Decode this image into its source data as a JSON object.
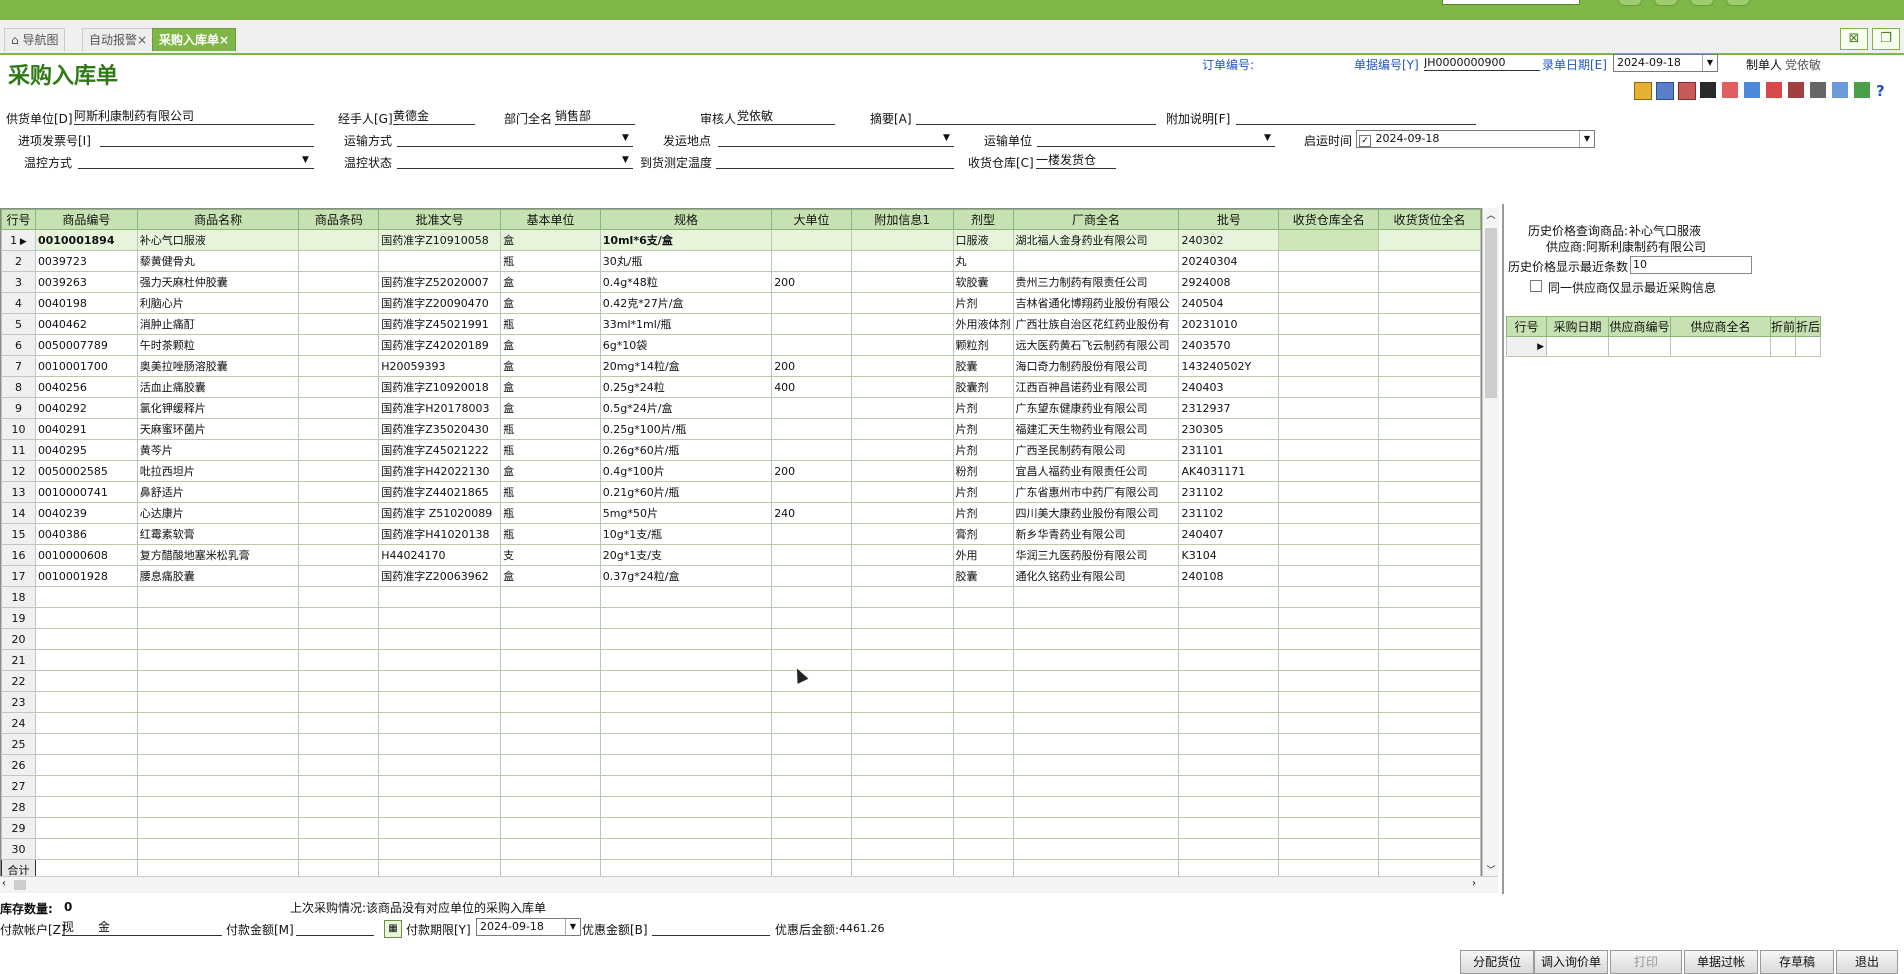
{
  "tabs": [
    {
      "label": "导航图",
      "icon": "home-icon"
    },
    {
      "label": "自动报警"
    },
    {
      "label": "采购入库单"
    }
  ],
  "page_title": "采购入库单",
  "header_top": {
    "order_no_label": "订单编号:",
    "doc_no_label": "单据编号[Y]",
    "doc_no_value": "JH0000000900",
    "entry_date_label": "录单日期[E]",
    "entry_date_value": "2024-09-18",
    "maker_label": "制单人",
    "maker_value": "党依敏"
  },
  "form": {
    "supplier_label": "供货单位[D]",
    "supplier_value": "阿斯利康制药有限公司",
    "handler_label": "经手人[G]",
    "handler_value": "黄德金",
    "dept_label": "部门全名",
    "dept_value": "销售部",
    "auditor_label": "审核人",
    "auditor_value": "党依敏",
    "summary_label": "摘要[A]",
    "summary_value": "",
    "extra_label": "附加说明[F]",
    "extra_value": "",
    "invoice_label": "进项发票号[I]",
    "transport_label": "运输方式",
    "ship_place_label": "发运地点",
    "carrier_label": "运输单位",
    "start_time_label": "启运时间",
    "start_time_value": "2024-09-18",
    "temp_method_label": "温控方式",
    "temp_status_label": "温控状态",
    "arrival_temp_label": "到货测定温度",
    "warehouse_label": "收货仓库[C]",
    "warehouse_value": "一楼发货仓"
  },
  "grid": {
    "columns": [
      "行号",
      "商品编号",
      "商品名称",
      "商品条码",
      "批准文号",
      "基本单位",
      "规格",
      "大单位",
      "附加信息1",
      "剂型",
      "厂商全名",
      "批号",
      "收货仓库全名",
      "收货货位全名"
    ],
    "rows": [
      [
        "1",
        "0010001894",
        "补心气口服液",
        "",
        "国药准字Z10910058",
        "盒",
        "10ml*6支/盒",
        "",
        "",
        "口服液",
        "湖北福人金身药业有限公司",
        "240302",
        "",
        ""
      ],
      [
        "2",
        "0039723",
        "藜黄健骨丸",
        "",
        "",
        "瓶",
        "30丸/瓶",
        "",
        "",
        "丸",
        "",
        "20240304",
        "",
        ""
      ],
      [
        "3",
        "0039263",
        "强力天麻杜仲胶囊",
        "",
        "国药准字Z52020007",
        "盒",
        "0.4g*48粒",
        "200",
        "",
        "软胶囊",
        "贵州三力制药有限责任公司",
        "2924008",
        "",
        ""
      ],
      [
        "4",
        "0040198",
        "利脑心片",
        "",
        "国药准字Z20090470",
        "盒",
        "0.42克*27片/盒",
        "",
        "",
        "片剂",
        "吉林省通化博翔药业股份有限公",
        "240504",
        "",
        ""
      ],
      [
        "5",
        "0040462",
        "消肿止痛酊",
        "",
        "国药准字Z45021991",
        "瓶",
        "33ml*1ml/瓶",
        "",
        "",
        "外用液体剂",
        "广西壮族自治区花红药业股份有",
        "20231010",
        "",
        ""
      ],
      [
        "6",
        "0050007789",
        "午时茶颗粒",
        "",
        "国药准字Z42020189",
        "盒",
        "6g*10袋",
        "",
        "",
        "颗粒剂",
        "远大医药黄石飞云制药有限公司",
        "2403570",
        "",
        ""
      ],
      [
        "7",
        "0010001700",
        "奥美拉唑肠溶胶囊",
        "",
        "H20059393",
        "盒",
        "20mg*14粒/盒",
        "200",
        "",
        "胶囊",
        "海口奇力制药股份有限公司",
        "143240502Y",
        "",
        ""
      ],
      [
        "8",
        "0040256",
        "活血止痛胶囊",
        "",
        "国药准字Z10920018",
        "盒",
        "0.25g*24粒",
        "400",
        "",
        "胶囊剂",
        "江西百神昌诺药业有限公司",
        "240403",
        "",
        ""
      ],
      [
        "9",
        "0040292",
        "氯化钾缓释片",
        "",
        "国药准字H20178003",
        "盒",
        "0.5g*24片/盒",
        "",
        "",
        "片剂",
        "广东望东健康药业有限公司",
        "2312937",
        "",
        ""
      ],
      [
        "10",
        "0040291",
        "天麻蜜环菌片",
        "",
        "国药准字Z35020430",
        "瓶",
        "0.25g*100片/瓶",
        "",
        "",
        "片剂",
        "福建汇天生物药业有限公司",
        "230305",
        "",
        ""
      ],
      [
        "11",
        "0040295",
        "黄芩片",
        "",
        "国药准字Z45021222",
        "瓶",
        "0.26g*60片/瓶",
        "",
        "",
        "片剂",
        "广西圣民制药有限公司",
        "231101",
        "",
        ""
      ],
      [
        "12",
        "0050002585",
        "吡拉西坦片",
        "",
        "国药准字H42022130",
        "盒",
        "0.4g*100片",
        "200",
        "",
        "粉剂",
        "宜昌人福药业有限责任公司",
        "AK4031171",
        "",
        ""
      ],
      [
        "13",
        "0010000741",
        "鼻舒适片",
        "",
        "国药准字Z44021865",
        "瓶",
        "0.21g*60片/瓶",
        "",
        "",
        "片剂",
        "广东省惠州市中药厂有限公司",
        "231102",
        "",
        ""
      ],
      [
        "14",
        "0040239",
        "心达康片",
        "",
        "国药准字 Z51020089",
        "瓶",
        "5mg*50片",
        "240",
        "",
        "片剂",
        "四川美大康药业股份有限公司",
        "231102",
        "",
        ""
      ],
      [
        "15",
        "0040386",
        "红霉素软膏",
        "",
        "国药准字H41020138",
        "瓶",
        "10g*1支/瓶",
        "",
        "",
        "膏剂",
        "新乡华青药业有限公司",
        "240407",
        "",
        ""
      ],
      [
        "16",
        "0010000608",
        "复方醋酸地塞米松乳膏",
        "",
        "H44024170",
        "支",
        "20g*1支/支",
        "",
        "",
        "外用",
        "华润三九医药股份有限公司",
        "K3104",
        "",
        ""
      ],
      [
        "17",
        "0010001928",
        "腰息痛胶囊",
        "",
        "国药准字Z20063962",
        "盒",
        "0.37g*24粒/盒",
        "",
        "",
        "胶囊",
        "通化久铭药业有限公司",
        "240108",
        "",
        ""
      ]
    ],
    "empty_rows": [
      "18",
      "19",
      "20",
      "21",
      "22",
      "23",
      "24",
      "25",
      "26",
      "27",
      "28",
      "29",
      "30"
    ],
    "total_label": "合计"
  },
  "right_panel": {
    "history_label": "历史价格查询商品:",
    "history_product": "补心气口服液",
    "supplier_label": "供应商:",
    "supplier_value": "阿斯利康制药有限公司",
    "count_label": "历史价格显示最近条数",
    "count_value": "10",
    "checkbox_label": "同一供应商仅显示最近采购信息",
    "columns": [
      "行号",
      "采购日期",
      "供应商编号",
      "供应商全名",
      "折前",
      "折后"
    ]
  },
  "footer": {
    "stock_label": "库存数量:",
    "stock_value": "0",
    "last_purchase": "上次采购情况:该商品没有对应单位的采购入库单",
    "pay_account_label": "付款帐户[Z]",
    "pay_account_value": "现　　金",
    "pay_amount_label": "付款金额[M]",
    "pay_deadline_label": "付款期限[Y]",
    "pay_deadline_value": "2024-09-18",
    "discount_label": "优惠金额[B]",
    "after_discount_label": "优惠后金额:",
    "after_discount_value": "4461.26"
  },
  "buttons": [
    "分配货位",
    "调入询价单",
    "打印",
    "单据过帐",
    "存草稿",
    "退出"
  ]
}
